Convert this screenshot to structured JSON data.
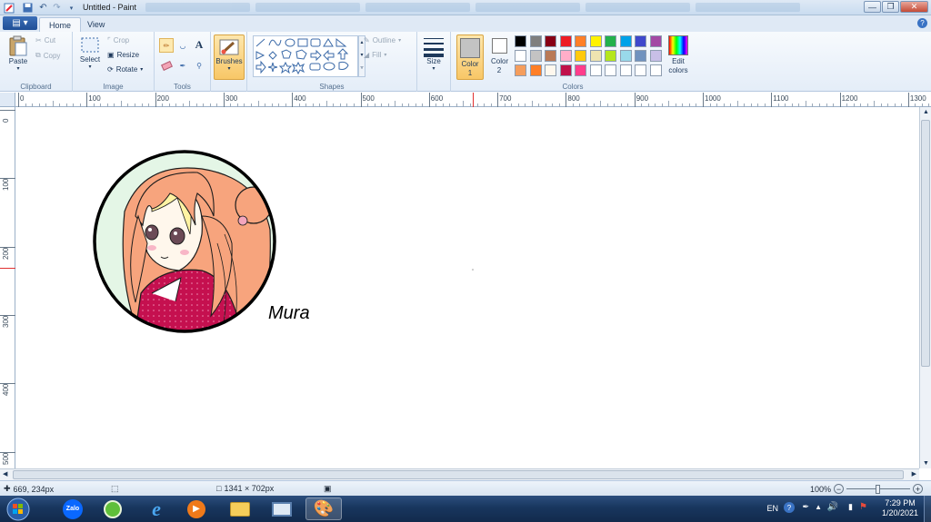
{
  "titlebar": {
    "title": "Untitled - Paint"
  },
  "tabs": {
    "home": "Home",
    "view": "View"
  },
  "clipboard": {
    "paste": "Paste",
    "cut": "Cut",
    "copy": "Copy",
    "label": "Clipboard"
  },
  "image": {
    "select": "Select",
    "crop": "Crop",
    "resize": "Resize",
    "rotate": "Rotate",
    "label": "Image"
  },
  "tools": {
    "label": "Tools"
  },
  "brushes": {
    "label": "Brushes"
  },
  "shapes": {
    "outline": "Outline",
    "fill": "Fill",
    "label": "Shapes"
  },
  "size": {
    "label": "Size"
  },
  "colors": {
    "color1": "Color 1",
    "color2": "Color 2",
    "edit": "Edit colors",
    "label": "Colors",
    "color1_value": "#c3c3c3",
    "color2_value": "#ffffff",
    "palette_row1": [
      "#000000",
      "#7f7f7f",
      "#880015",
      "#ed1c24",
      "#ff7f27",
      "#fff200",
      "#22b14c",
      "#00a2e8",
      "#3f48cc",
      "#a349a4"
    ],
    "palette_row2": [
      "#ffffff",
      "#c3c3c3",
      "#b97a57",
      "#ffaec9",
      "#ffc90e",
      "#efe4b0",
      "#b5e61d",
      "#99d9ea",
      "#7092be",
      "#c8bfe7"
    ],
    "palette_row3": [
      "#f59d5c",
      "#ff7f27",
      "#fff8ee",
      "#c0104a",
      "#ff3d8b",
      "#ffffff",
      "#ffffff",
      "#ffffff",
      "#ffffff",
      "#ffffff"
    ]
  },
  "ruler": {
    "h": [
      "0",
      "100",
      "200",
      "300",
      "400",
      "500",
      "600",
      "700",
      "800",
      "900",
      "1000",
      "1100",
      "1200",
      "1300"
    ],
    "v": [
      "0",
      "100",
      "200",
      "300",
      "400",
      "500"
    ]
  },
  "canvas": {
    "signature": "Mura"
  },
  "status": {
    "cursor": "669, 234px",
    "size": "1341 × 702px",
    "zoom": "100%"
  },
  "tray": {
    "lang": "EN",
    "time": "7:29 PM",
    "date": "1/20/2021"
  },
  "taskbar": {
    "zalo": "Zalo"
  }
}
